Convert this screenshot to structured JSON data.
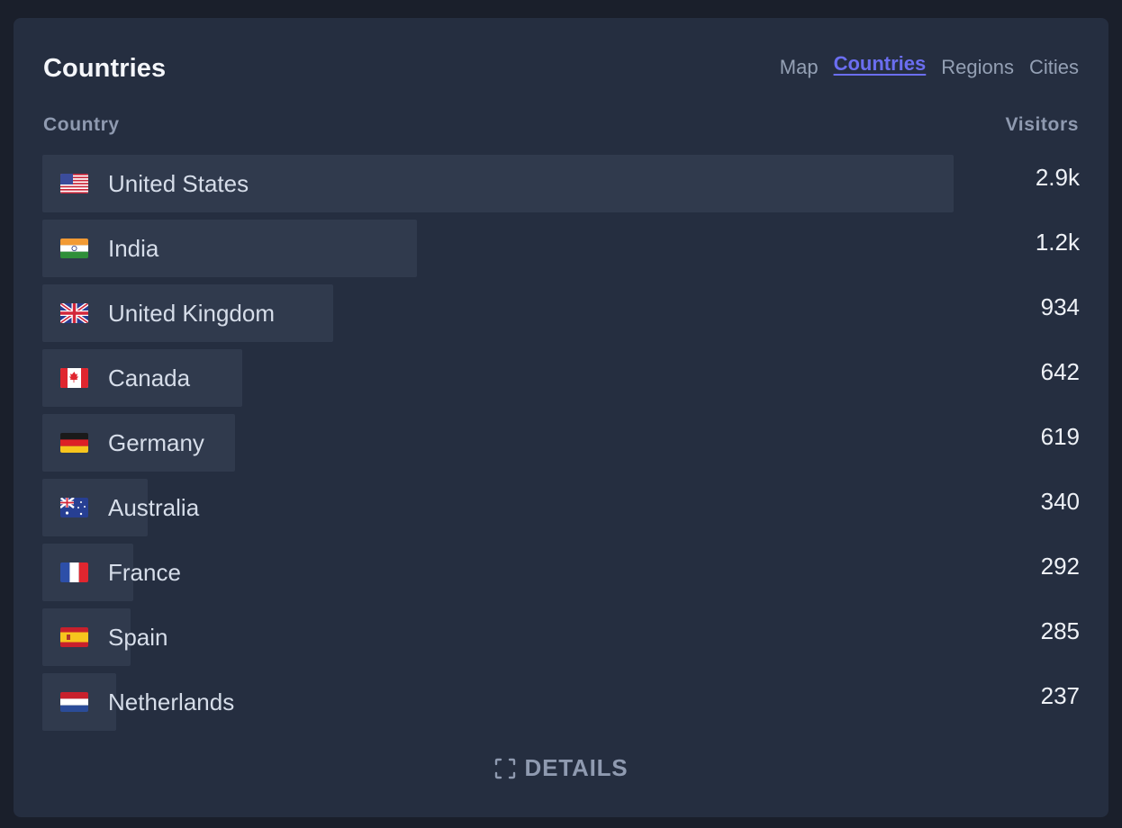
{
  "panel": {
    "title": "Countries",
    "tabs": [
      {
        "label": "Map",
        "active": false
      },
      {
        "label": "Countries",
        "active": true
      },
      {
        "label": "Regions",
        "active": false
      },
      {
        "label": "Cities",
        "active": false
      }
    ],
    "columns": {
      "country": "Country",
      "visitors": "Visitors"
    },
    "details_label": "DETAILS",
    "details_icon": "expand-frame-icon"
  },
  "colors": {
    "accent": "#6b6ef0",
    "bar": "#303a4d",
    "panel": "#252e40",
    "background": "#1a1f2b"
  },
  "rows": [
    {
      "country": "United States",
      "flag": "us",
      "visitors": "2.9k",
      "share": 1.0
    },
    {
      "country": "India",
      "flag": "in",
      "visitors": "1.2k",
      "share": 0.411
    },
    {
      "country": "United Kingdom",
      "flag": "gb",
      "visitors": "934",
      "share": 0.319
    },
    {
      "country": "Canada",
      "flag": "ca",
      "visitors": "642",
      "share": 0.219
    },
    {
      "country": "Germany",
      "flag": "de",
      "visitors": "619",
      "share": 0.211
    },
    {
      "country": "Australia",
      "flag": "au",
      "visitors": "340",
      "share": 0.116
    },
    {
      "country": "France",
      "flag": "fr",
      "visitors": "292",
      "share": 0.1
    },
    {
      "country": "Spain",
      "flag": "es",
      "visitors": "285",
      "share": 0.097
    },
    {
      "country": "Netherlands",
      "flag": "nl",
      "visitors": "237",
      "share": 0.081
    }
  ]
}
